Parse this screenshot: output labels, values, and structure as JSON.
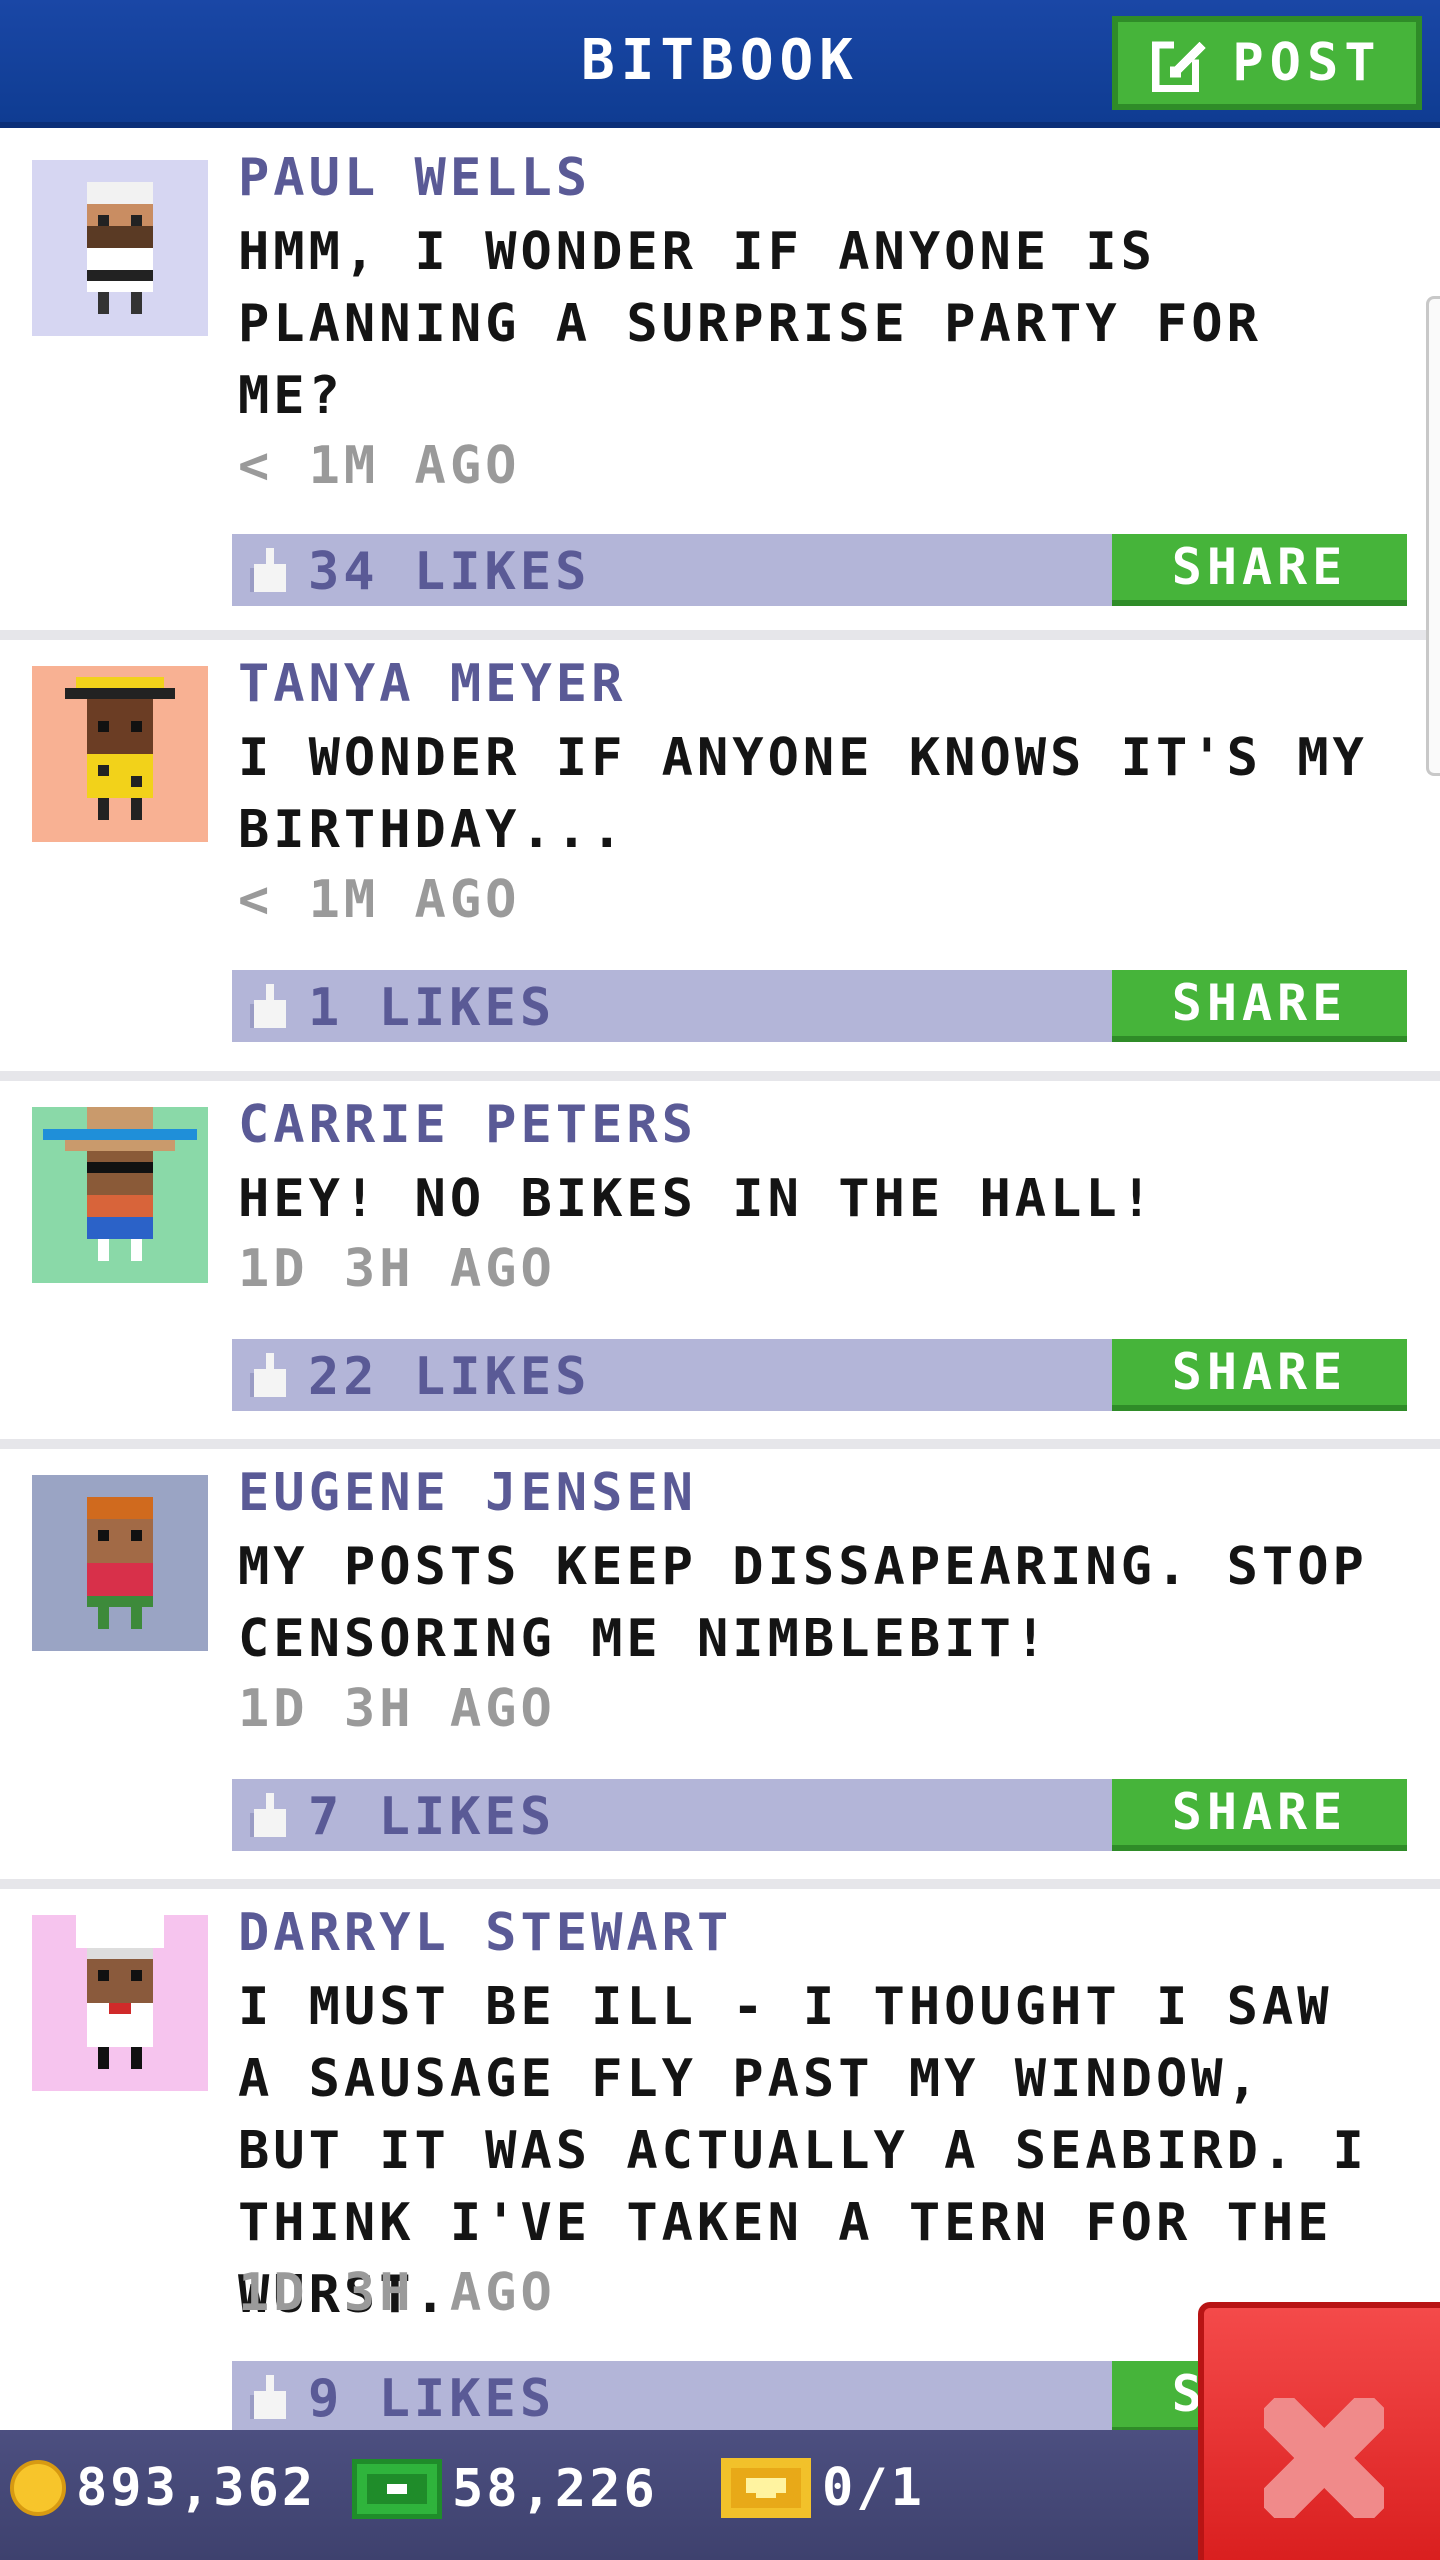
{
  "header": {
    "title": "BITBOOK",
    "post_label": "POST"
  },
  "share_label": "SHARE",
  "posts": [
    {
      "author": "PAUL WELLS",
      "message": "HMM, I WONDER IF ANYONE IS PLANNING A SURPRISE PARTY FOR ME?",
      "time": "< 1M AGO",
      "likes": "34 LIKES",
      "avatar_bg": "#d6d6f2"
    },
    {
      "author": "TANYA MEYER",
      "message": "I WONDER IF ANYONE KNOWS IT'S MY BIRTHDAY...",
      "time": "< 1M AGO",
      "likes": "1 LIKES",
      "avatar_bg": "#f8b193"
    },
    {
      "author": "CARRIE PETERS",
      "message": "HEY! NO BIKES IN THE HALL!",
      "time": "1D 3H AGO",
      "likes": "22 LIKES",
      "avatar_bg": "#8ad9a8"
    },
    {
      "author": "EUGENE JENSEN",
      "message": "MY POSTS KEEP DISSAPEARING. STOP CENSORING ME NIMBLEBIT!",
      "time": "1D 3H AGO",
      "likes": "7 LIKES",
      "avatar_bg": "#9aa4c4"
    },
    {
      "author": "DARRYL STEWART",
      "message": "I MUST BE ILL - I THOUGHT I SAW A SAUSAGE FLY PAST MY WINDOW, BUT IT WAS ACTUALLY A SEABIRD. I THINK I'VE TAKEN A TERN FOR THE WURST.",
      "time": "1D 3H AGO",
      "likes": "9 LIKES",
      "avatar_bg": "#f6c4ee"
    }
  ],
  "status": {
    "coins": "893,362",
    "bux": "58,226",
    "tickets": "0/1"
  },
  "colors": {
    "header_blue": "#1a47a6",
    "share_green": "#46b43a",
    "like_bar": "#b3b5d8",
    "author_purple": "#5a5a96",
    "status_bar": "#4c4f80",
    "close_red": "#e02828"
  },
  "icons": {
    "post": "edit-icon",
    "like": "thumbs-up-icon",
    "coin": "coin-icon",
    "bux": "bux-icon",
    "ticket": "golden-ticket-icon",
    "close": "close-icon"
  }
}
